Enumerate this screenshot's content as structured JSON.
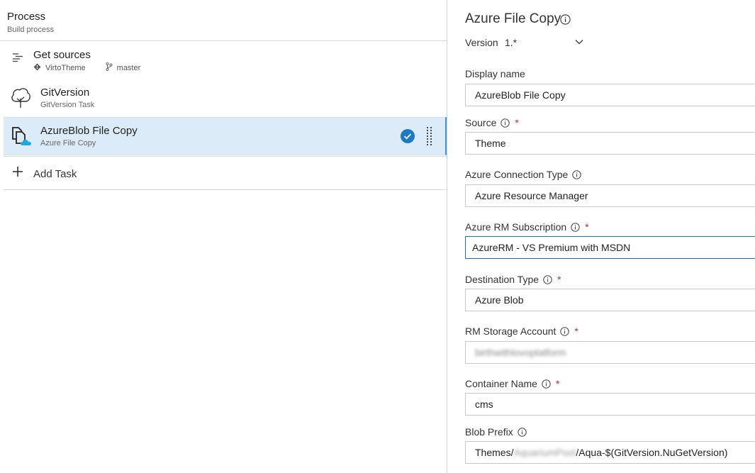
{
  "process": {
    "title": "Process",
    "subtitle": "Build process"
  },
  "tasks": [
    {
      "title": "Get sources",
      "repo": "VirtoTheme",
      "branch": "master",
      "icon": "list-icon"
    },
    {
      "title": "GitVersion",
      "subtitle": "GitVersion Task",
      "icon": "tree-icon"
    },
    {
      "title": "AzureBlob File Copy",
      "subtitle": "Azure File Copy",
      "icon": "azure-file-copy-icon",
      "selected": true
    }
  ],
  "add_task": {
    "label": "Add Task"
  },
  "panel": {
    "title": "Azure File Copy",
    "version_label": "Version",
    "version_value": "1.*"
  },
  "fields": [
    {
      "label": "Display name",
      "value": "AzureBlob File Copy",
      "info": false,
      "required": false
    },
    {
      "label": "Source",
      "value": "Theme",
      "info": true,
      "required": true
    },
    {
      "label": "Azure Connection Type",
      "value": "Azure Resource Manager",
      "info": true,
      "required": false
    },
    {
      "label": "Azure RM Subscription",
      "value": "AzureRM - VS Premium with MSDN",
      "info": true,
      "required": true,
      "focused": true
    },
    {
      "label": "Destination Type",
      "value": "Azure Blob",
      "info": true,
      "required": true
    },
    {
      "label": "RM Storage Account",
      "value": "birthwithlovoplatform",
      "info": true,
      "required": true,
      "blurred": true
    },
    {
      "label": "Container Name",
      "value": "cms",
      "info": true,
      "required": true
    },
    {
      "label": "Blob Prefix",
      "value_prefix": "Themes/",
      "value_blurred": "AquariumPool",
      "value_suffix": "/Aqua-$(GitVersion.NuGetVersion)",
      "info": true,
      "required": false
    }
  ],
  "colors": {
    "selected_row": "#dcebf8",
    "accent": "#1e78c8",
    "required": "#c4262e",
    "focus_border": "#1f6fbf"
  },
  "required_mark": "*"
}
